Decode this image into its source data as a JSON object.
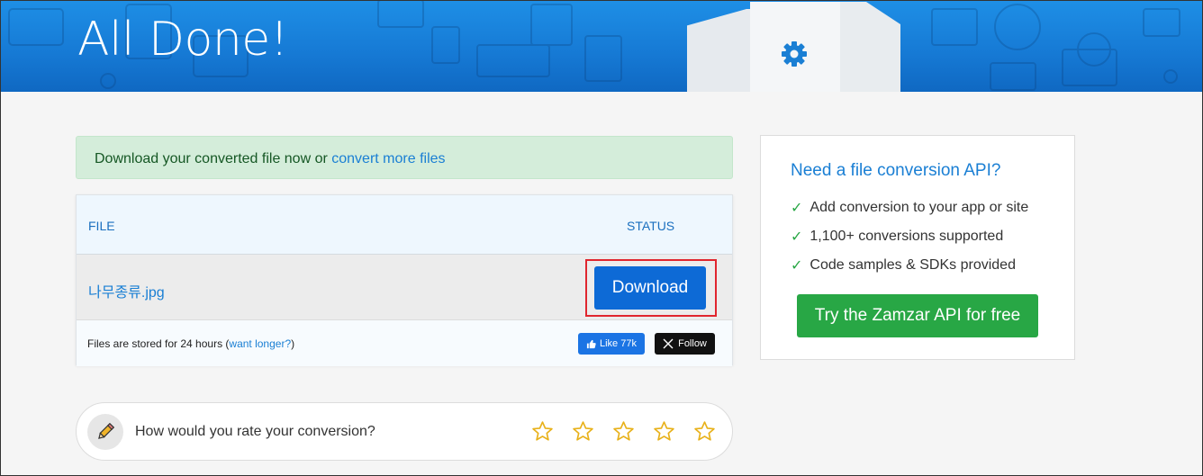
{
  "header": {
    "title": "All Done!"
  },
  "alert": {
    "text": "Download your converted file now or ",
    "link": "convert more files"
  },
  "table": {
    "col_file": "FILE",
    "col_status": "STATUS",
    "rows": [
      {
        "filename": "나무종류.jpg",
        "action": "Download"
      }
    ],
    "footer_text": "Files are stored for 24 hours (",
    "footer_link": "want longer?",
    "footer_close": ")",
    "like_label": "Like 77k",
    "follow_label": "Follow"
  },
  "rating": {
    "question": "How would you rate your conversion?",
    "stars": 5
  },
  "api": {
    "title": "Need a file conversion API?",
    "features": [
      "Add conversion to your app or site",
      "1,100+ conversions supported",
      "Code samples & SDKs provided"
    ],
    "cta": "Try the Zamzar API for free"
  },
  "colors": {
    "brand_blue": "#1679d4",
    "download_blue": "#0d6ad6",
    "cta_green": "#28a745",
    "highlight_red": "#e0262e"
  },
  "icons": [
    "gear-icon",
    "like-icon",
    "x-logo-icon",
    "pencil-icon",
    "star-icon",
    "check-icon"
  ]
}
